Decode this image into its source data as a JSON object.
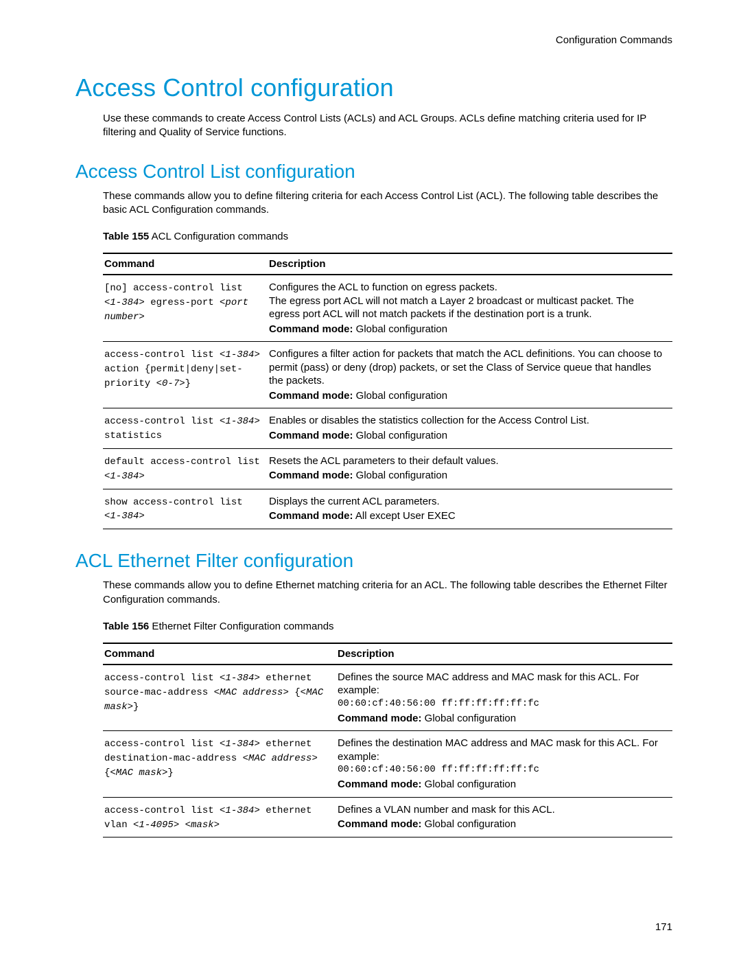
{
  "header": {
    "right": "Configuration Commands"
  },
  "h1": "Access Control configuration",
  "intro1": "Use these commands to create Access Control Lists (ACLs) and ACL Groups. ACLs define matching criteria used for IP filtering and Quality of Service functions.",
  "section1": {
    "heading": "Access Control List configuration",
    "intro": "These commands allow you to define filtering criteria for each Access Control List (ACL). The following table describes the basic ACL Configuration commands.",
    "table_caption_label": "Table 155",
    "table_caption": " ACL Configuration commands",
    "col1": "Command",
    "col2": "Description",
    "rows": [
      {
        "cmd_parts": [
          {
            "t": "[no] access-control list ",
            "i": false
          },
          {
            "t": "<1-384>",
            "i": true
          },
          {
            "t": " egress-port ",
            "i": false
          },
          {
            "t": "<port number>",
            "i": true
          }
        ],
        "desc": "Configures the ACL to function on egress packets.\nThe egress port ACL will not match a Layer 2 broadcast or multicast packet. The egress port ACL will not match packets if the destination port is a trunk.",
        "mode_label": "Command mode:",
        "mode": " Global configuration"
      },
      {
        "cmd_parts": [
          {
            "t": "access-control list ",
            "i": false
          },
          {
            "t": "<1-384>",
            "i": true
          },
          {
            "t": " action {permit|deny|set-priority ",
            "i": false
          },
          {
            "t": "<0-7>",
            "i": true
          },
          {
            "t": "}",
            "i": false
          }
        ],
        "desc": "Configures a filter action for packets that match the ACL definitions. You can choose to permit (pass) or deny (drop) packets, or set the Class of Service queue that handles the packets.",
        "mode_label": "Command mode:",
        "mode": " Global configuration"
      },
      {
        "cmd_parts": [
          {
            "t": "access-control list ",
            "i": false
          },
          {
            "t": "<1-384>",
            "i": true
          },
          {
            "t": " statistics",
            "i": false
          }
        ],
        "desc": "Enables or disables the statistics collection for the Access Control List.",
        "mode_label": "Command mode:",
        "mode": " Global configuration"
      },
      {
        "cmd_parts": [
          {
            "t": "default access-control list ",
            "i": false
          },
          {
            "t": "<1-384>",
            "i": true
          }
        ],
        "desc": "Resets the ACL parameters to their default values.",
        "mode_label": "Command mode:",
        "mode": " Global configuration"
      },
      {
        "cmd_parts": [
          {
            "t": "show access-control list ",
            "i": false
          },
          {
            "t": "<1-384>",
            "i": true
          }
        ],
        "desc": "Displays the current ACL parameters.",
        "mode_label": "Command mode:",
        "mode": " All except User EXEC"
      }
    ]
  },
  "section2": {
    "heading": "ACL Ethernet Filter configuration",
    "intro": "These commands allow you to define Ethernet matching criteria for an ACL. The following table describes the Ethernet Filter Configuration commands.",
    "table_caption_label": "Table 156",
    "table_caption": " Ethernet Filter Configuration commands",
    "col1": "Command",
    "col2": "Description",
    "rows": [
      {
        "cmd_parts": [
          {
            "t": "access-control list ",
            "i": false
          },
          {
            "t": "<1-384>",
            "i": true
          },
          {
            "t": " ethernet source-mac-address ",
            "i": false
          },
          {
            "t": "<MAC address>",
            "i": true
          },
          {
            "t": " {",
            "i": false
          },
          {
            "t": "<MAC mask>",
            "i": true
          },
          {
            "t": "}",
            "i": false
          }
        ],
        "desc": "Defines the source MAC address and MAC mask for this ACL. For example:",
        "example": "00:60:cf:40:56:00 ff:ff:ff:ff:ff:fc",
        "mode_label": "Command mode:",
        "mode": " Global configuration"
      },
      {
        "cmd_parts": [
          {
            "t": "access-control list ",
            "i": false
          },
          {
            "t": "<1-384>",
            "i": true
          },
          {
            "t": " ethernet destination-mac-address ",
            "i": false
          },
          {
            "t": "<MAC address>",
            "i": true
          },
          {
            "t": " {",
            "i": false
          },
          {
            "t": "<MAC mask>",
            "i": true
          },
          {
            "t": "}",
            "i": false
          }
        ],
        "desc": "Defines the destination MAC address and MAC mask for this ACL. For example:",
        "example": "00:60:cf:40:56:00 ff:ff:ff:ff:ff:fc",
        "mode_label": "Command mode:",
        "mode": " Global configuration"
      },
      {
        "cmd_parts": [
          {
            "t": "access-control list ",
            "i": false
          },
          {
            "t": "<1-384>",
            "i": true
          },
          {
            "t": " ethernet vlan ",
            "i": false
          },
          {
            "t": "<1-4095> <mask>",
            "i": true
          }
        ],
        "desc": "Defines a VLAN number and mask for this ACL.",
        "mode_label": "Command mode:",
        "mode": " Global configuration"
      }
    ]
  },
  "page_number": "171"
}
